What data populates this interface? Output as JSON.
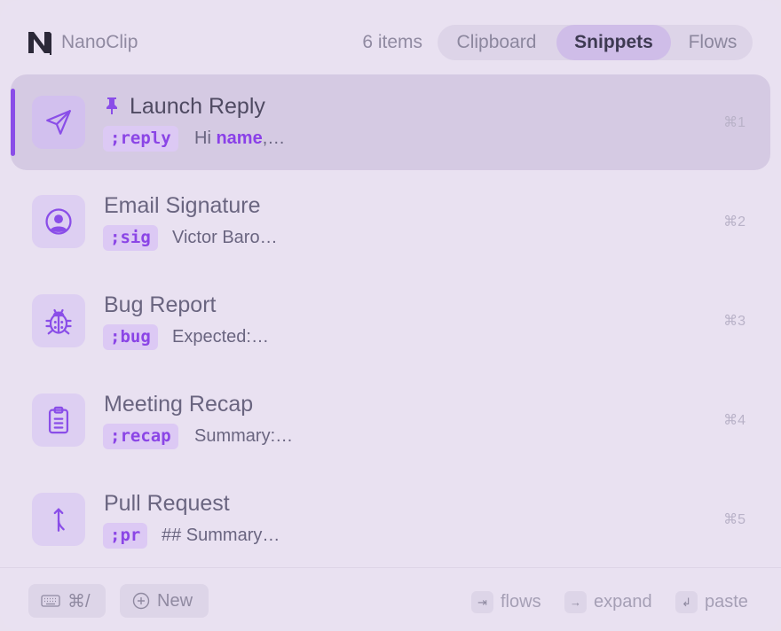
{
  "header": {
    "app_name": "NanoClip",
    "item_count": "6 items",
    "tabs": [
      {
        "label": "Clipboard",
        "active": false
      },
      {
        "label": "Snippets",
        "active": true
      },
      {
        "label": "Flows",
        "active": false
      }
    ]
  },
  "snippets": [
    {
      "title": "Launch Reply",
      "pinned": true,
      "tag": ";reply",
      "preview_prefix": "Hi ",
      "preview_var": "name",
      "preview_suffix": ",…",
      "shortcut": "⌘1",
      "icon": "send-icon",
      "selected": true
    },
    {
      "title": "Email Signature",
      "pinned": false,
      "tag": ";sig",
      "preview": "Victor Baro…",
      "shortcut": "⌘2",
      "icon": "user-circle-icon"
    },
    {
      "title": "Bug Report",
      "pinned": false,
      "tag": ";bug",
      "preview": "Expected:…",
      "shortcut": "⌘3",
      "icon": "bug-icon"
    },
    {
      "title": "Meeting Recap",
      "pinned": false,
      "tag": ";recap",
      "preview": "Summary:…",
      "shortcut": "⌘4",
      "icon": "clipboard-list-icon"
    },
    {
      "title": "Pull Request",
      "pinned": false,
      "tag": ";pr",
      "preview": "## Summary…",
      "shortcut": "⌘5",
      "icon": "git-merge-icon"
    }
  ],
  "footer": {
    "keyboard_shortcut": "⌘/",
    "new_label": "New",
    "hints": [
      {
        "key": "⇥",
        "label": "flows"
      },
      {
        "key": "→",
        "label": "expand"
      },
      {
        "key": "↲",
        "label": "paste"
      }
    ]
  },
  "colors": {
    "background": "#e9e1f1",
    "accent": "#8a4ee8",
    "selected_row": "#d5cae3",
    "tag_bg": "#dcc9f4"
  }
}
